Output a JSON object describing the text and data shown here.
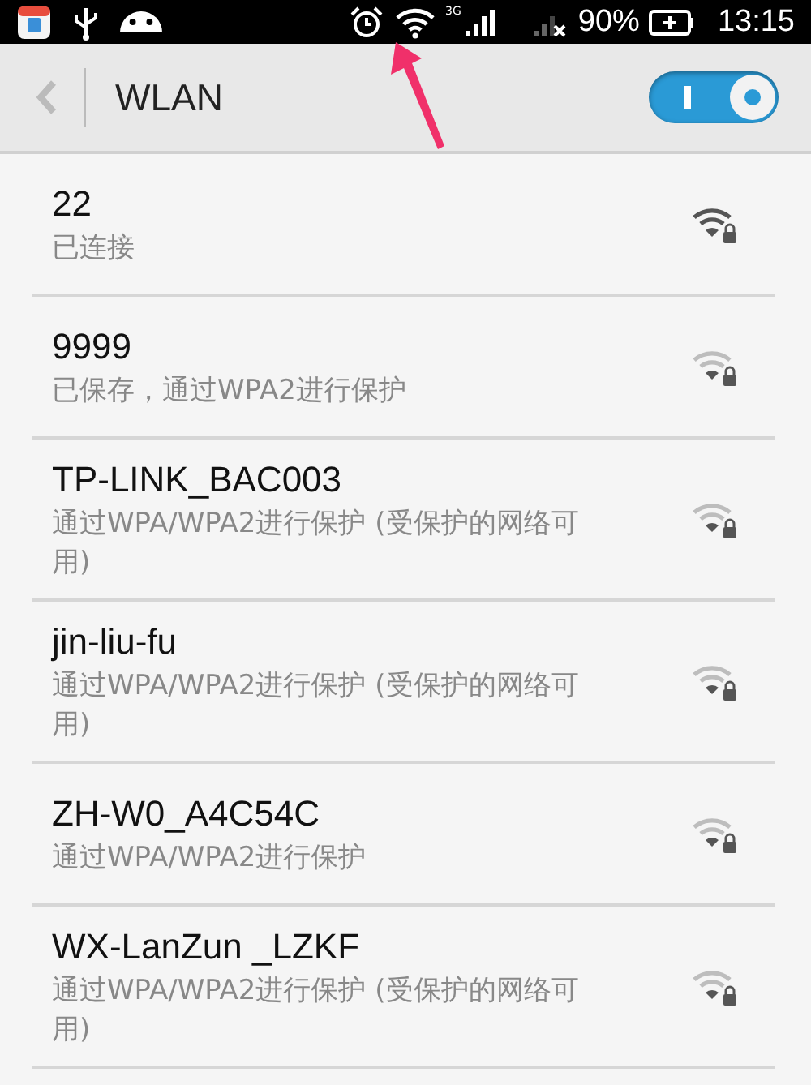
{
  "status_bar": {
    "network": "3G",
    "battery": "90%",
    "time": "13:15"
  },
  "header": {
    "title": "WLAN",
    "wifi_on": true
  },
  "networks": [
    {
      "name": "22",
      "status": "已连接",
      "connected": true
    },
    {
      "name": "9999",
      "status": "已保存，通过WPA2进行保护",
      "connected": false
    },
    {
      "name": "TP-LINK_BAC003",
      "status": "通过WPA/WPA2进行保护 (受保护的网络可用)",
      "connected": false
    },
    {
      "name": "jin-liu-fu",
      "status": "通过WPA/WPA2进行保护 (受保护的网络可用)",
      "connected": false
    },
    {
      "name": "ZH-W0_A4C54C",
      "status": "通过WPA/WPA2进行保护",
      "connected": false
    },
    {
      "name": "WX-LanZun _LZKF",
      "status": "通过WPA/WPA2进行保护 (受保护的网络可用)",
      "connected": false
    }
  ]
}
